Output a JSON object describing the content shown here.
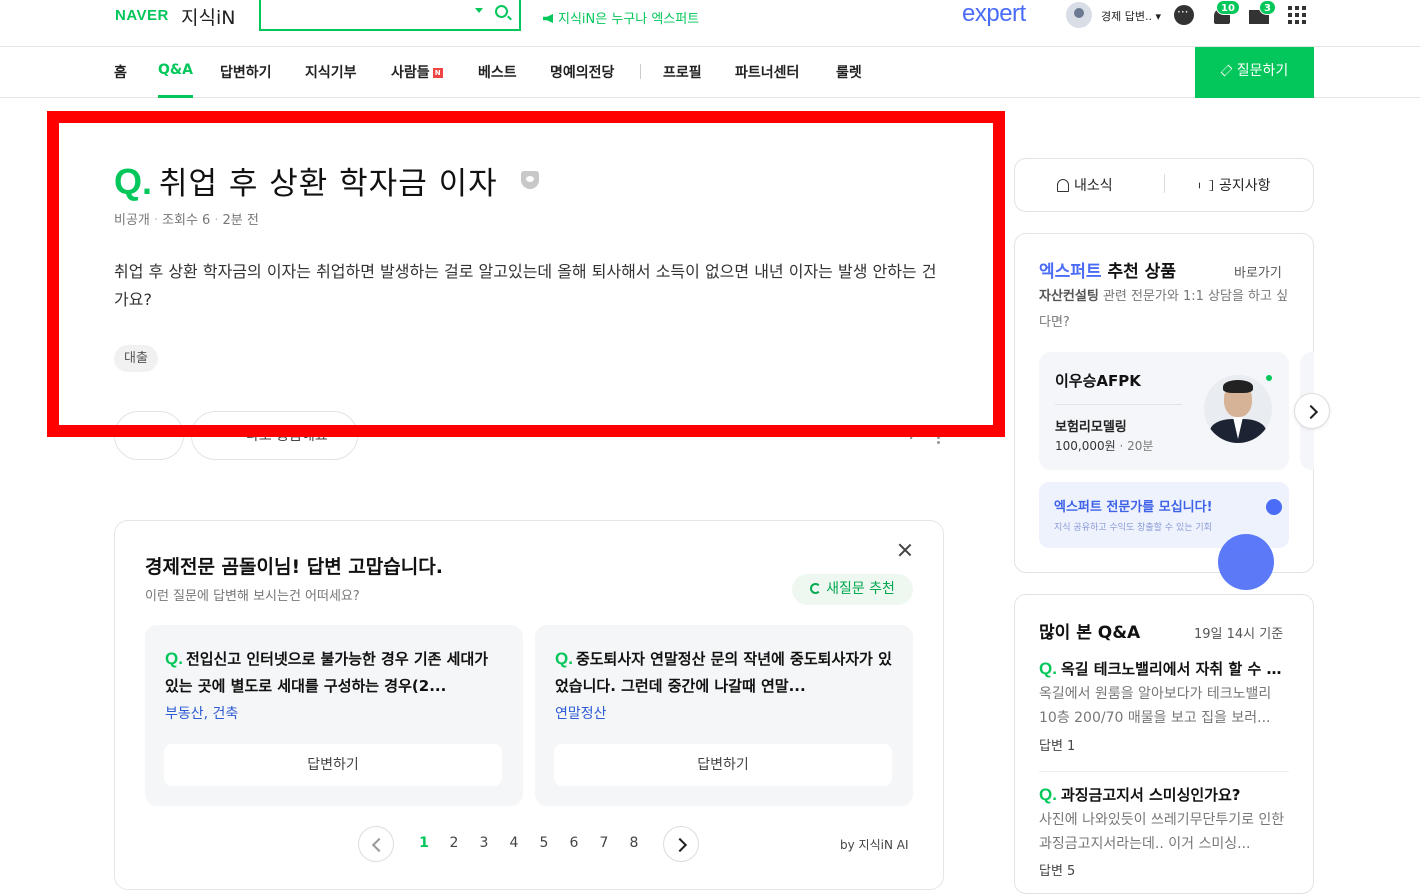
{
  "header": {
    "brand": "NAVER",
    "service": "지식iN",
    "search_placeholder": "",
    "promo": "지식iN은 누구나 엑스퍼트",
    "expert_logo": "expert",
    "user_name": "경제 답변..",
    "notification_count": "10",
    "mail_count": "3",
    "accent_color": "#03c75a",
    "expert_color": "#4a6cf7"
  },
  "nav": {
    "items": [
      {
        "label": "홈"
      },
      {
        "label": "Q&A",
        "active": true
      },
      {
        "label": "답변하기"
      },
      {
        "label": "지식기부"
      },
      {
        "label": "사람들",
        "badge": "N"
      },
      {
        "label": "베스트"
      },
      {
        "label": "명예의전당"
      },
      {
        "label": "프로필"
      },
      {
        "label": "파트너센터"
      },
      {
        "label": "룰렛"
      }
    ],
    "ask_button": "질문하기"
  },
  "question": {
    "q_mark": "Q.",
    "title": "취업 후 상환 학자금 이자",
    "privacy": "비공개",
    "views": "조회수 6",
    "time": "2분 전",
    "body": "취업 후 상환 학자금의 이자는 취업하면 발생하는 걸로 알고있는데 올해 퇴사해서 소득이 없으면 내년 이자는 발생 안하는 건가요?",
    "tag": "대출",
    "partial_action": "나도 궁금해요"
  },
  "recommend": {
    "title": "경제전문 곰돌이님! 답변 고맙습니다.",
    "subtitle": "이런 질문에 답변해 보시는건 어떠세요?",
    "refresh_button": "새질문 추천",
    "cards": [
      {
        "text": "전입신고 인터넷으로 불가능한 경우 기존 세대가 있는 곳에 별도로 세대를 구성하는 경우(2...",
        "category": "부동산, 건축",
        "answer_button": "답변하기"
      },
      {
        "text": "중도퇴사자 연말정산 문의 작년에 중도퇴사자가 있었습니다. 그런데 중간에 나갈때 연말...",
        "category": "연말정산",
        "answer_button": "답변하기"
      }
    ],
    "pages": [
      "1",
      "2",
      "3",
      "4",
      "5",
      "6",
      "7",
      "8"
    ],
    "current_page": "1",
    "by_label": "by 지식iN AI"
  },
  "sidebar": {
    "my_news": "내소식",
    "notice": "공지사항",
    "expert_brand": "엑스퍼트",
    "expert_section": "추천 상품",
    "expert_more": "바로가기",
    "expert_desc_bold": "자산컨설팅",
    "expert_desc": "관련 전문가와 1:1 상담을 하고 싶다면?",
    "expert_card": {
      "name": "이우승AFPK",
      "product": "보험리모델링",
      "price": "100,000원",
      "duration": "20분"
    },
    "recruit_title": "엑스퍼트 전문가를 모십니다!",
    "recruit_sub": "지식 공유하고 수익도 창출할 수 있는 기회",
    "popular_title": "많이 본 Q&A",
    "popular_time": "19일 14시 기준",
    "popular": [
      {
        "title": "옥길 테크노밸리에서 자취 할 수 있을까요?",
        "body": "옥길에서 원룸을 알아보다가 테크노밸리 10층 200/70 매물을 보고 집을 보러...",
        "answers": "답변 1"
      },
      {
        "title": "과징금고지서 스미싱인가요?",
        "body": "사진에 나와있듯이 쓰레기무단투기로 인한 과징금고지서라는데.. 이거 스미싱...",
        "answers": "답변 5"
      }
    ]
  }
}
